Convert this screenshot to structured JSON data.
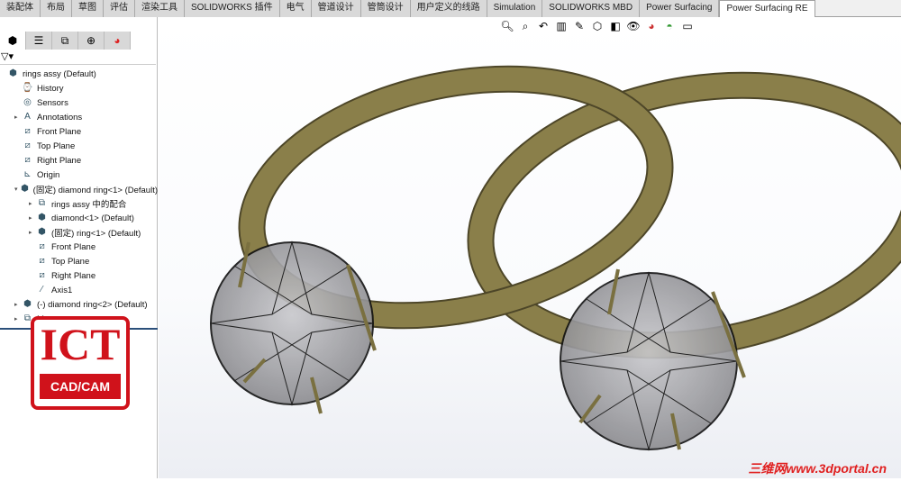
{
  "tabs": [
    "装配体",
    "布局",
    "草图",
    "评估",
    "渲染工具",
    "SOLIDWORKS 插件",
    "电气",
    "管道设计",
    "管筒设计",
    "用户定义的线路",
    "Simulation",
    "SOLIDWORKS MBD",
    "Power Surfacing",
    "Power Surfacing RE"
  ],
  "active_tab": "Power Surfacing RE",
  "panel_tabs": [
    "feature-manager",
    "property-manager",
    "configuration-manager",
    "dimxpert",
    "display-manager"
  ],
  "filter_icon": "▽▾",
  "tree": [
    {
      "label": "rings assy  (Default)",
      "icon": "assembly",
      "level": 0,
      "arrow": ""
    },
    {
      "label": "History",
      "icon": "history",
      "level": 1,
      "arrow": ""
    },
    {
      "label": "Sensors",
      "icon": "sensors",
      "level": 1,
      "arrow": ""
    },
    {
      "label": "Annotations",
      "icon": "annotations",
      "level": 1,
      "arrow": "▸"
    },
    {
      "label": "Front Plane",
      "icon": "plane",
      "level": 1,
      "arrow": ""
    },
    {
      "label": "Top Plane",
      "icon": "plane",
      "level": 1,
      "arrow": ""
    },
    {
      "label": "Right Plane",
      "icon": "plane",
      "level": 1,
      "arrow": ""
    },
    {
      "label": "Origin",
      "icon": "origin",
      "level": 1,
      "arrow": ""
    },
    {
      "label": "(固定) diamond ring<1> (Default)",
      "icon": "subassembly",
      "level": 1,
      "arrow": "▾"
    },
    {
      "label": "rings assy 中的配合",
      "icon": "mates",
      "level": 2,
      "arrow": "▸"
    },
    {
      "label": "diamond<1> (Default)",
      "icon": "part",
      "level": 2,
      "arrow": "▸"
    },
    {
      "label": "(固定) ring<1> (Default)",
      "icon": "part",
      "level": 2,
      "arrow": "▸"
    },
    {
      "label": "Front Plane",
      "icon": "plane",
      "level": 2,
      "arrow": ""
    },
    {
      "label": "Top Plane",
      "icon": "plane",
      "level": 2,
      "arrow": ""
    },
    {
      "label": "Right Plane",
      "icon": "plane",
      "level": 2,
      "arrow": ""
    },
    {
      "label": "Axis1",
      "icon": "axis",
      "level": 2,
      "arrow": ""
    },
    {
      "label": "(-) diamond ring<2> (Default)",
      "icon": "subassembly",
      "level": 1,
      "arrow": "▸"
    },
    {
      "label": "Mates",
      "icon": "mates",
      "level": 1,
      "arrow": "▸"
    }
  ],
  "view_tools": [
    "zoom-to-fit",
    "zoom-to-area",
    "previous-view",
    "section-view",
    "dynamic-annotation",
    "view-orientation",
    "display-style",
    "hide-show",
    "edit-appearance",
    "apply-scene",
    "view-settings"
  ],
  "logo": {
    "top": "ICT",
    "bottom": "CAD/CAM"
  },
  "watermark": "三维网www.3dportal.cn",
  "colors": {
    "ring": "#8a7f4a",
    "diamond": "#a6a6aa",
    "logo": "#d0121b"
  }
}
